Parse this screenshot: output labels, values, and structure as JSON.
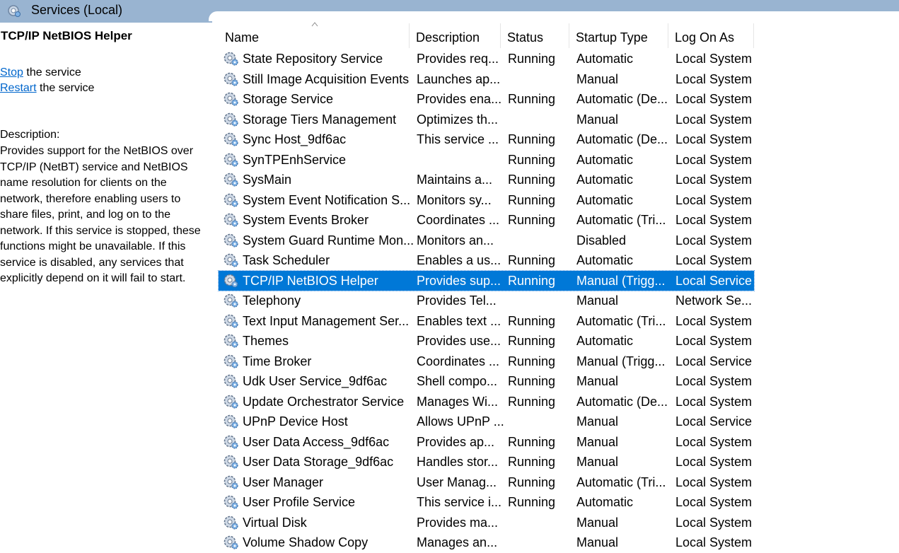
{
  "window": {
    "title": "Services (Local)"
  },
  "left_pane": {
    "service_name": "TCP/IP NetBIOS Helper",
    "actions": [
      {
        "link": "Stop",
        "suffix": " the service"
      },
      {
        "link": "Restart",
        "suffix": " the service"
      }
    ],
    "description_label": "Description:",
    "description": "Provides support for the NetBIOS over TCP/IP (NetBT) service and NetBIOS name resolution for clients on the network, therefore enabling users to share files, print, and log on to the network. If this service is stopped, these functions might be unavailable. If this service is disabled, any services that explicitly depend on it will fail to start."
  },
  "columns": {
    "name": "Name",
    "description": "Description",
    "status": "Status",
    "startup_type": "Startup Type",
    "log_on_as": "Log On As"
  },
  "rows": [
    {
      "name": "State Repository Service",
      "description": "Provides req...",
      "status": "Running",
      "startup": "Automatic",
      "logon": "Local System"
    },
    {
      "name": "Still Image Acquisition Events",
      "description": "Launches ap...",
      "status": "",
      "startup": "Manual",
      "logon": "Local System"
    },
    {
      "name": "Storage Service",
      "description": "Provides ena...",
      "status": "Running",
      "startup": "Automatic (De...",
      "logon": "Local System"
    },
    {
      "name": "Storage Tiers Management",
      "description": "Optimizes th...",
      "status": "",
      "startup": "Manual",
      "logon": "Local System"
    },
    {
      "name": "Sync Host_9df6ac",
      "description": "This service ...",
      "status": "Running",
      "startup": "Automatic (De...",
      "logon": "Local System"
    },
    {
      "name": "SynTPEnhService",
      "description": "",
      "status": "Running",
      "startup": "Automatic",
      "logon": "Local System"
    },
    {
      "name": "SysMain",
      "description": "Maintains a...",
      "status": "Running",
      "startup": "Automatic",
      "logon": "Local System"
    },
    {
      "name": "System Event Notification S...",
      "description": "Monitors sy...",
      "status": "Running",
      "startup": "Automatic",
      "logon": "Local System"
    },
    {
      "name": "System Events Broker",
      "description": "Coordinates ...",
      "status": "Running",
      "startup": "Automatic (Tri...",
      "logon": "Local System"
    },
    {
      "name": "System Guard Runtime Mon...",
      "description": "Monitors an...",
      "status": "",
      "startup": "Disabled",
      "logon": "Local System"
    },
    {
      "name": "Task Scheduler",
      "description": "Enables a us...",
      "status": "Running",
      "startup": "Automatic",
      "logon": "Local System"
    },
    {
      "name": "TCP/IP NetBIOS Helper",
      "description": "Provides sup...",
      "status": "Running",
      "startup": "Manual (Trigg...",
      "logon": "Local Service",
      "selected": true
    },
    {
      "name": "Telephony",
      "description": "Provides Tel...",
      "status": "",
      "startup": "Manual",
      "logon": "Network Se..."
    },
    {
      "name": "Text Input Management Ser...",
      "description": "Enables text ...",
      "status": "Running",
      "startup": "Automatic (Tri...",
      "logon": "Local System"
    },
    {
      "name": "Themes",
      "description": "Provides use...",
      "status": "Running",
      "startup": "Automatic",
      "logon": "Local System"
    },
    {
      "name": "Time Broker",
      "description": "Coordinates ...",
      "status": "Running",
      "startup": "Manual (Trigg...",
      "logon": "Local Service"
    },
    {
      "name": "Udk User Service_9df6ac",
      "description": "Shell compo...",
      "status": "Running",
      "startup": "Manual",
      "logon": "Local System"
    },
    {
      "name": "Update Orchestrator Service",
      "description": "Manages Wi...",
      "status": "Running",
      "startup": "Automatic (De...",
      "logon": "Local System"
    },
    {
      "name": "UPnP Device Host",
      "description": "Allows UPnP ...",
      "status": "",
      "startup": "Manual",
      "logon": "Local Service"
    },
    {
      "name": "User Data Access_9df6ac",
      "description": "Provides ap...",
      "status": "Running",
      "startup": "Manual",
      "logon": "Local System"
    },
    {
      "name": "User Data Storage_9df6ac",
      "description": "Handles stor...",
      "status": "Running",
      "startup": "Manual",
      "logon": "Local System"
    },
    {
      "name": "User Manager",
      "description": "User Manag...",
      "status": "Running",
      "startup": "Automatic (Tri...",
      "logon": "Local System"
    },
    {
      "name": "User Profile Service",
      "description": "This service i...",
      "status": "Running",
      "startup": "Automatic",
      "logon": "Local System"
    },
    {
      "name": "Virtual Disk",
      "description": "Provides ma...",
      "status": "",
      "startup": "Manual",
      "logon": "Local System"
    },
    {
      "name": "Volume Shadow Copy",
      "description": "Manages an...",
      "status": "",
      "startup": "Manual",
      "logon": "Local System"
    }
  ],
  "icons": {
    "title": "services-gear-icon",
    "row": "service-gear-icon",
    "sort": "sort-ascending-icon"
  },
  "colors": {
    "title_bar": "#99b4d1",
    "selection": "#0078d7",
    "link": "#0066cc"
  }
}
